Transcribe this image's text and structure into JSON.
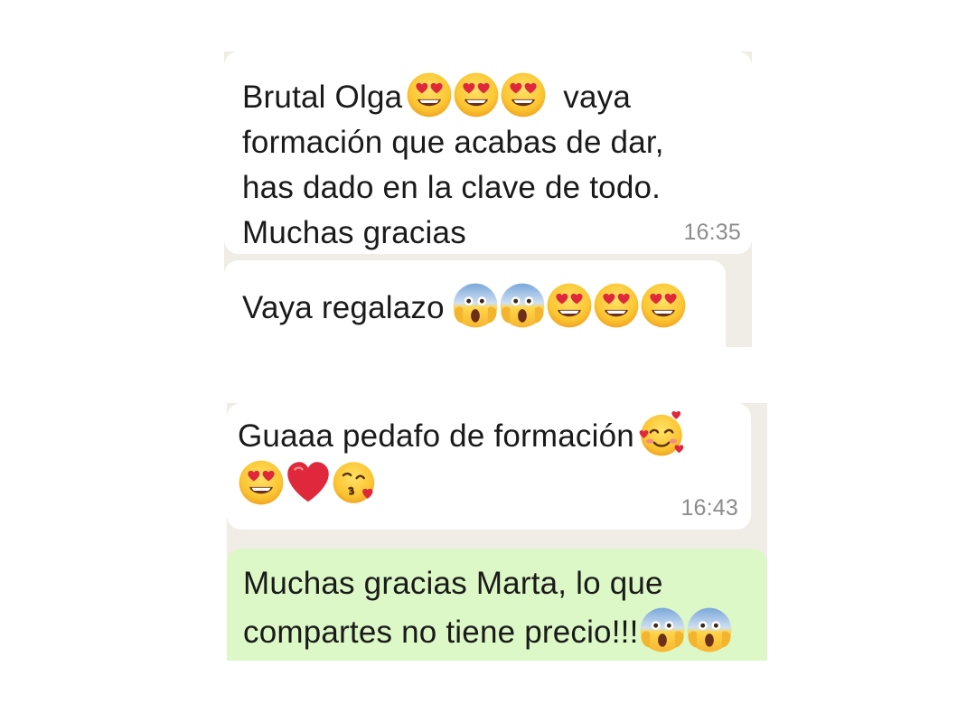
{
  "chat_top": {
    "messages": [
      {
        "lines": [
          "Brutal Olga",
          "vaya",
          "formación que acabas de dar,",
          "has dado en la clave de todo.",
          "Muchas gracias"
        ],
        "emojis": [
          "heart-eyes",
          "heart-eyes",
          "heart-eyes"
        ],
        "time": "16:35"
      },
      {
        "text": "Vaya regalazo",
        "emojis": [
          "screaming-face",
          "screaming-face",
          "heart-eyes",
          "heart-eyes",
          "heart-eyes"
        ],
        "time": ""
      }
    ]
  },
  "chat_bottom": {
    "messages": [
      {
        "text": "Guaaa pedafo de formación",
        "emojis": [
          "smiling-face-with-hearts",
          "heart-eyes",
          "red-heart",
          "face-blowing-kiss"
        ],
        "time": "16:43"
      },
      {
        "lines": [
          "Muchas gracias Marta, lo que",
          "compartes no tiene precio!!!"
        ],
        "emojis": [
          "screaming-face",
          "screaming-face"
        ],
        "outgoing": true
      }
    ]
  },
  "colors": {
    "incoming_bubble": "#ffffff",
    "outgoing_bubble": "#dcf8c6",
    "chat_background": "#f0ece6",
    "timestamp": "#8c8c8c"
  }
}
